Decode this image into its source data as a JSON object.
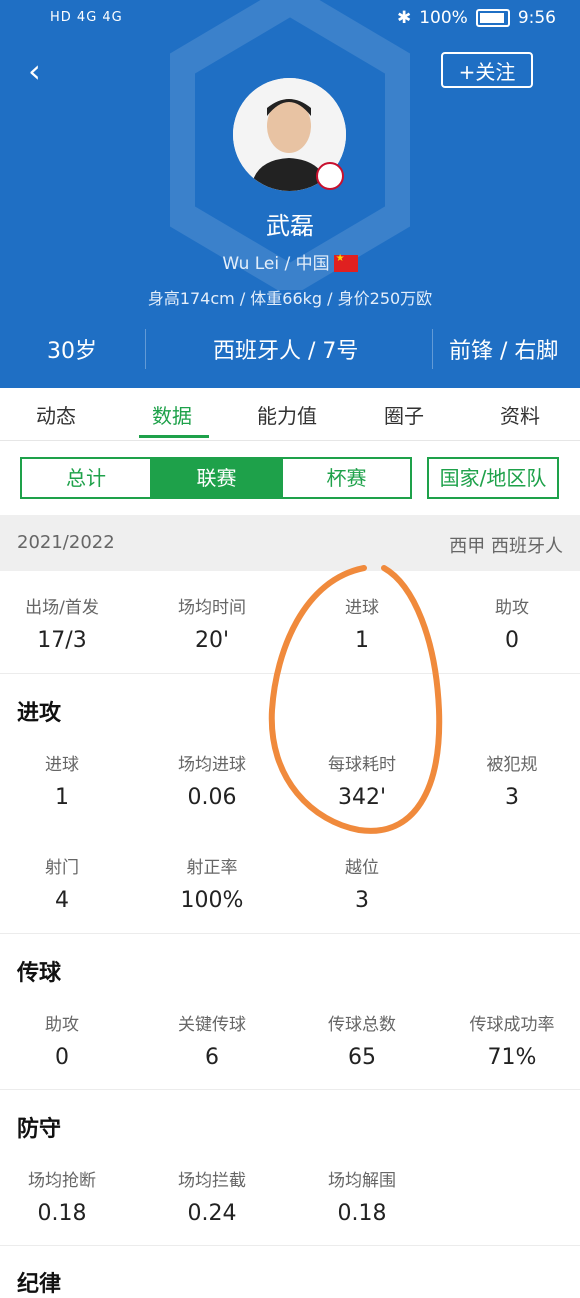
{
  "status_bar": {
    "left": "HD 4G 4G",
    "battery": "100%",
    "time": "9:56"
  },
  "header": {
    "follow_label": "+关注",
    "player_name": "武磊",
    "name_line": "Wu Lei / 中国",
    "physical": "身高174cm / 体重66kg / 身价250万欧",
    "age": "30岁",
    "club_number": "西班牙人 / 7号",
    "position_foot": "前锋 / 右脚"
  },
  "tabs": [
    "动态",
    "数据",
    "能力值",
    "圈子",
    "资料"
  ],
  "segments": [
    "总计",
    "联赛",
    "杯赛",
    "国家/地区队"
  ],
  "season": {
    "year": "2021/2022",
    "league": "西甲 西班牙人"
  },
  "summary": [
    {
      "label": "出场/首发",
      "value": "17/3"
    },
    {
      "label": "场均时间",
      "value": "20'"
    },
    {
      "label": "进球",
      "value": "1"
    },
    {
      "label": "助攻",
      "value": "0"
    }
  ],
  "attack": {
    "title": "进攻",
    "row1": [
      {
        "label": "进球",
        "value": "1"
      },
      {
        "label": "场均进球",
        "value": "0.06"
      },
      {
        "label": "每球耗时",
        "value": "342'"
      },
      {
        "label": "被犯规",
        "value": "3"
      }
    ],
    "row2": [
      {
        "label": "射门",
        "value": "4"
      },
      {
        "label": "射正率",
        "value": "100%"
      },
      {
        "label": "越位",
        "value": "3"
      }
    ]
  },
  "passing": {
    "title": "传球",
    "row": [
      {
        "label": "助攻",
        "value": "0"
      },
      {
        "label": "关键传球",
        "value": "6"
      },
      {
        "label": "传球总数",
        "value": "65"
      },
      {
        "label": "传球成功率",
        "value": "71%"
      }
    ]
  },
  "defense": {
    "title": "防守",
    "row": [
      {
        "label": "场均抢断",
        "value": "0.18"
      },
      {
        "label": "场均拦截",
        "value": "0.24"
      },
      {
        "label": "场均解围",
        "value": "0.18"
      }
    ]
  },
  "discipline": {
    "title": "纪律"
  },
  "colors": {
    "header_blue": "#1f6fc4",
    "accent_green": "#1ea14a",
    "annotation_orange": "#f08a3c"
  }
}
